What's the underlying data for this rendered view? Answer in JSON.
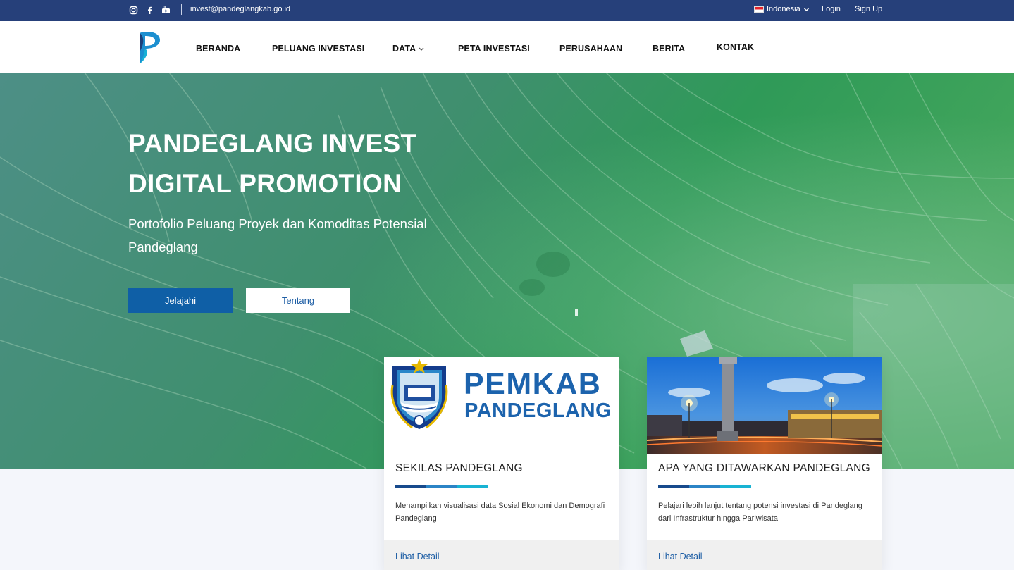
{
  "topbar": {
    "social_icons": [
      "instagram-icon",
      "facebook-icon",
      "youtube-icon"
    ],
    "email": "invest@pandeglangkab.go.id",
    "language": "Indonesia",
    "login": "Login",
    "signup": "Sign Up"
  },
  "nav": {
    "items": [
      "BERANDA",
      "PELUANG INVESTASI",
      "DATA",
      "PETA INVESTASI",
      "PERUSAHAAN",
      "BERITA",
      "KONTAK"
    ]
  },
  "hero": {
    "title_line1": "PANDEGLANG INVEST",
    "title_line2": "DIGITAL PROMOTION",
    "subtitle": "Portofolio  Peluang Proyek dan Komoditas Potensial Pandeglang",
    "primary_button": "Jelajahi",
    "secondary_button": "Tentang"
  },
  "cards": [
    {
      "logo_line1": "PEMKAB",
      "logo_line2": "PANDEGLANG",
      "title": "SEKILAS PANDEGLANG",
      "description": "Menampilkan visualisasi data Sosial Ekonomi dan Demografi Pandeglang",
      "link": "Lihat Detail"
    },
    {
      "title": "APA YANG DITAWARKAN PANDEGLANG",
      "description": "Pelajari lebih lanjut tentang potensi investasi di Pandeglang dari Infrastruktur hingga Pariwisata",
      "link": "Lihat Detail"
    }
  ],
  "colors": {
    "topbar": "#26407a",
    "primary": "#0f5fa6",
    "accent_bars": [
      "#174a8c",
      "#2b84c6",
      "#18b3d3"
    ],
    "link": "#1f5fa5"
  }
}
